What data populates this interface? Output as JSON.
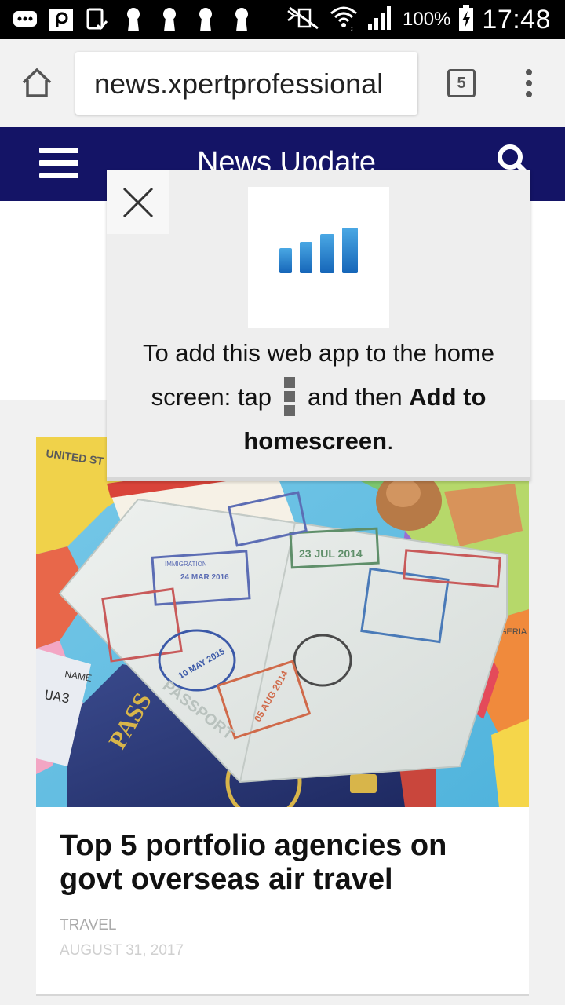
{
  "status_bar": {
    "battery": "100%",
    "time": "17:48",
    "left_icons": [
      "message-icon",
      "p-app-icon",
      "tablet-check-icon",
      "keyhole-icon",
      "keyhole-icon",
      "keyhole-icon",
      "keyhole-icon"
    ],
    "right_icons": [
      "mute-icon",
      "wifi-icon",
      "signal-icon",
      "battery-charging-icon"
    ]
  },
  "browser": {
    "url": "news.xpertprofessional",
    "tab_count": "5"
  },
  "site": {
    "title": "News Update",
    "header_color": "#141466"
  },
  "popup": {
    "text_before": "To add this web app to the home screen: tap",
    "text_middle": "and then",
    "bold_1": "Add to homescreen",
    "text_end": ".",
    "icon": "signal-bars-logo"
  },
  "article": {
    "title": "Top 5 portfolio agencies on govt overseas air travel",
    "category": "TRAVEL",
    "date": "AUGUST 31, 2017",
    "image": "passport-on-map-photo",
    "image_texts": {
      "stamp_date_1": "23 JUL 2014",
      "stamp_date_2": "24 MAR 2016",
      "stamp_date_3": "10 MAY 2015",
      "stamp_date_4": "05 AUG 2014",
      "passport_word": "PASSPORT",
      "pass_cover": "PASS",
      "immigration": "IMMIGRATION",
      "name_label": "NAME",
      "ua_code": "UA3",
      "nigeria": "NIGERIA",
      "united_states": "UNITED ST"
    }
  }
}
